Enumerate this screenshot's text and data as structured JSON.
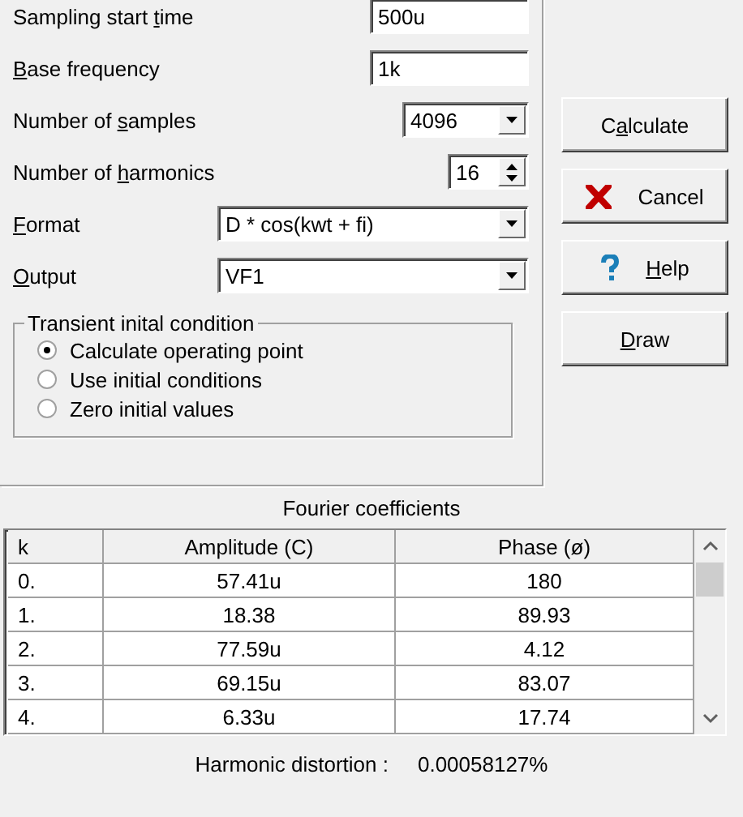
{
  "fields": [
    {
      "kind": "text",
      "label": {
        "before": "Sampling start ",
        "key": "t",
        "after": "ime"
      },
      "value": "500u"
    },
    {
      "kind": "text",
      "label": {
        "key": "B",
        "after": "ase frequency"
      },
      "value": "1k"
    },
    {
      "kind": "combo",
      "label": {
        "before": "Number of ",
        "key": "s",
        "after": "amples"
      },
      "value": "4096"
    },
    {
      "kind": "spin",
      "label": {
        "before": "Number of ",
        "key": "h",
        "after": "armonics"
      },
      "value": "16"
    },
    {
      "kind": "combo-wide",
      "label": {
        "key": "F",
        "after": "ormat"
      },
      "value": "D * cos(kwt + fi)"
    },
    {
      "kind": "combo-wide",
      "label": {
        "key": "O",
        "after": "utput"
      },
      "value": "VF1"
    }
  ],
  "group": {
    "title": "Transient inital condition",
    "options": [
      {
        "label": "Calculate operating point",
        "selected": true
      },
      {
        "label": "Use initial conditions",
        "selected": false
      },
      {
        "label": "Zero initial values",
        "selected": false
      }
    ]
  },
  "buttons": [
    {
      "kind": "plain",
      "label": {
        "before": "C",
        "key": "a",
        "after": "lculate"
      }
    },
    {
      "kind": "cancel",
      "label": {
        "after": "Cancel"
      }
    },
    {
      "kind": "help",
      "label": {
        "key": "H",
        "after": "elp"
      }
    },
    {
      "kind": "plain",
      "label": {
        "key": "D",
        "after": "raw"
      }
    }
  ],
  "table": {
    "title": "Fourier coefficients",
    "columns": [
      "k",
      "Amplitude (C)",
      "Phase (ø)"
    ],
    "rows": [
      [
        "0.",
        "57.41u",
        "180"
      ],
      [
        "1.",
        "18.38",
        "89.93"
      ],
      [
        "2.",
        "77.59u",
        "4.12"
      ],
      [
        "3.",
        "69.15u",
        "83.07"
      ],
      [
        "4.",
        "6.33u",
        "17.74"
      ]
    ]
  },
  "distortion": {
    "label": "Harmonic distortion :",
    "value": "0.00058127%"
  }
}
